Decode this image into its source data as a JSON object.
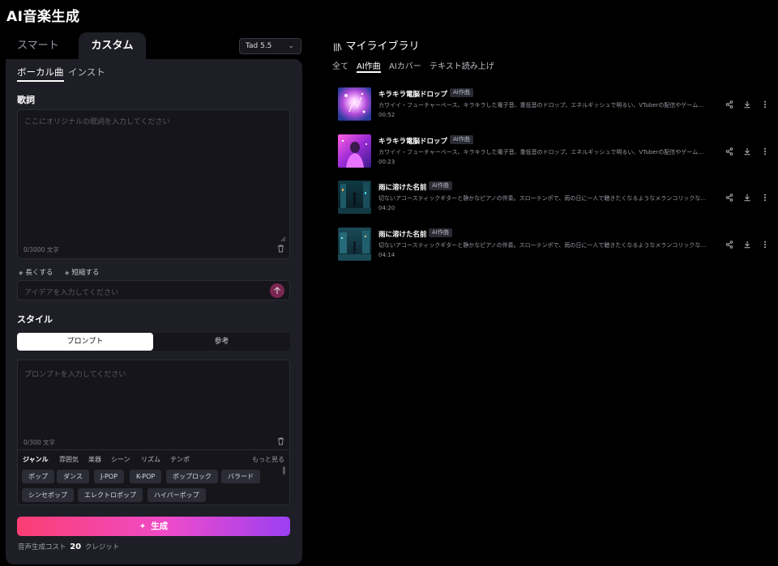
{
  "app": {
    "title": "AI音楽生成"
  },
  "mode_tabs": {
    "smart": "スマート",
    "custom": "カスタム"
  },
  "model_select": {
    "value": "Tad 5.5"
  },
  "sub_tabs": {
    "vocal": "ボーカル曲",
    "instrumental": "インスト"
  },
  "lyrics": {
    "label": "歌詞",
    "placeholder": "ここにオリジナルの歌詞を入力してください",
    "counter": "0/3000 文字"
  },
  "edit_actions": {
    "lengthen": "長くする",
    "shorten": "短縮する"
  },
  "idea": {
    "placeholder": "アイデアを入力してください"
  },
  "style": {
    "label": "スタイル",
    "toggle": {
      "prompt": "プロンプト",
      "reference": "参考"
    },
    "prompt_placeholder": "プロンプトを入力してください",
    "counter": "0/300 文字",
    "categories": [
      "ジャンル",
      "雰囲気",
      "楽器",
      "シーン",
      "リズム",
      "テンポ"
    ],
    "more": "もっと見る",
    "tags_row1": [
      "ポップ",
      "ダンス",
      "J-POP",
      "K-POP",
      "ポップロック",
      "バラード"
    ],
    "tags_row2": [
      "シンセポップ",
      "エレクトロポップ",
      "ハイパーポップ"
    ]
  },
  "generate": {
    "label": "生成"
  },
  "cost": {
    "prefix": "音声生成コスト",
    "amount": "20",
    "unit": "クレジット"
  },
  "library": {
    "title": "マイライブラリ",
    "tabs": [
      "全て",
      "AI作曲",
      "AIカバー",
      "テキスト読み上げ"
    ],
    "tracks": [
      {
        "title": "キラキラ電脳ドロップ",
        "badge": "AI作曲",
        "desc": "カワイイ・フューチャーベース、キラキラした電子音、重低音のドロップ、エネルギッシュで明るい、VTuberの配信やゲーム…",
        "duration": "00:52"
      },
      {
        "title": "キラキラ電脳ドロップ",
        "badge": "AI作曲",
        "desc": "カワイイ・フューチャーベース、キラキラした電子音、重低音のドロップ、エネルギッシュで明るい、VTuberの配信やゲーム…",
        "duration": "00:23"
      },
      {
        "title": "雨に溶けた名前",
        "badge": "AI作曲",
        "desc": "切ないアコースティックギターと静かなピアノの伴奏。スローテンポで、雨の日に一人で聴きたくなるようなメランコリックな…",
        "duration": "04:20"
      },
      {
        "title": "雨に溶けた名前",
        "badge": "AI作曲",
        "desc": "切ないアコースティックギターと静かなピアノの伴奏。スローテンポで、雨の日に一人で聴きたくなるようなメランコリックな…",
        "duration": "04:14"
      }
    ]
  }
}
